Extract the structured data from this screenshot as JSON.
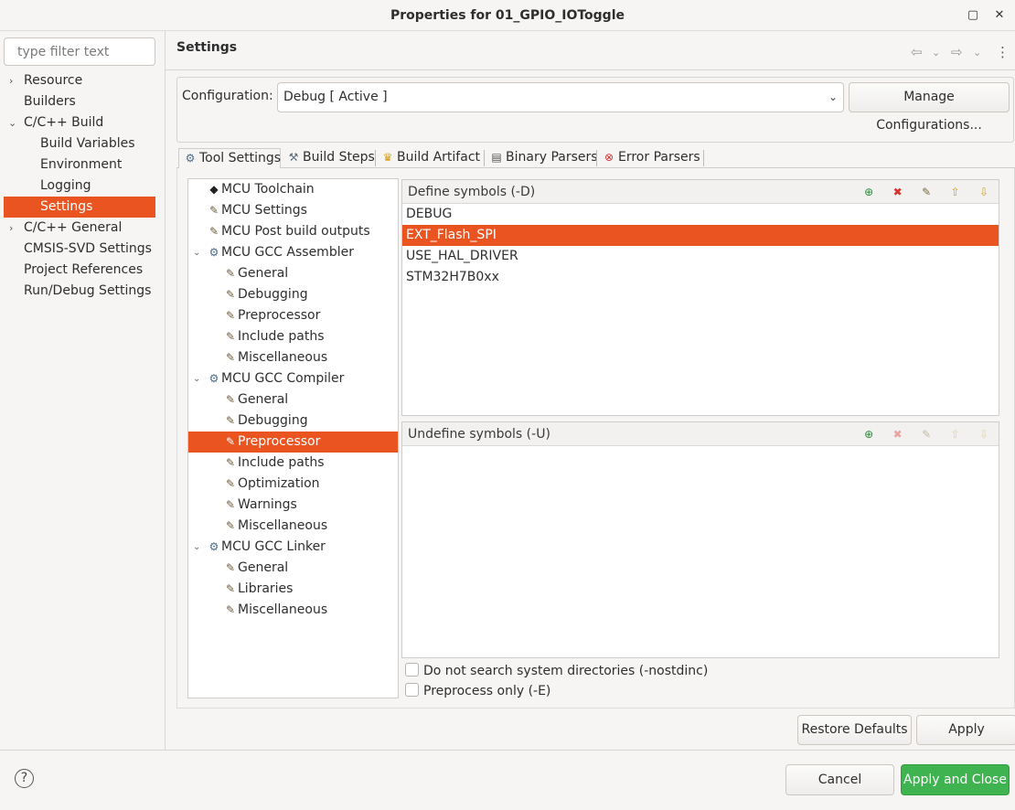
{
  "window": {
    "title": "Properties for 01_GPIO_IOToggle"
  },
  "filter": {
    "placeholder": "type filter text"
  },
  "nav": {
    "items": [
      {
        "label": "Resource",
        "arrow": "›"
      },
      {
        "label": "Builders"
      },
      {
        "label": "C/C++ Build",
        "arrow": "⌄"
      },
      {
        "label": "Build Variables"
      },
      {
        "label": "Environment"
      },
      {
        "label": "Logging"
      },
      {
        "label": "Settings",
        "selected": true
      },
      {
        "label": "C/C++ General",
        "arrow": "›"
      },
      {
        "label": "CMSIS-SVD Settings"
      },
      {
        "label": "Project References"
      },
      {
        "label": "Run/Debug Settings"
      }
    ]
  },
  "page": {
    "title": "Settings"
  },
  "config": {
    "label": "Configuration:",
    "value": "Debug  [ Active ]",
    "manage_label": "Manage Configurations..."
  },
  "tabs": [
    {
      "label": "Tool Settings",
      "icon": "tool-settings-icon",
      "active": true
    },
    {
      "label": "Build Steps",
      "icon": "build-steps-icon"
    },
    {
      "label": "Build Artifact",
      "icon": "trophy-icon"
    },
    {
      "label": "Binary Parsers",
      "icon": "binary-parser-icon"
    },
    {
      "label": "Error Parsers",
      "icon": "error-icon"
    }
  ],
  "tree": {
    "items": [
      {
        "label": "MCU Toolchain"
      },
      {
        "label": "MCU Settings"
      },
      {
        "label": "MCU Post build outputs"
      },
      {
        "label": "MCU GCC Assembler"
      },
      {
        "label": "General"
      },
      {
        "label": "Debugging"
      },
      {
        "label": "Preprocessor"
      },
      {
        "label": "Include paths"
      },
      {
        "label": "Miscellaneous"
      },
      {
        "label": "MCU GCC Compiler"
      },
      {
        "label": "General"
      },
      {
        "label": "Debugging"
      },
      {
        "label": "Preprocessor",
        "selected": true
      },
      {
        "label": "Include paths"
      },
      {
        "label": "Optimization"
      },
      {
        "label": "Warnings"
      },
      {
        "label": "Miscellaneous"
      },
      {
        "label": "MCU GCC Linker"
      },
      {
        "label": "General"
      },
      {
        "label": "Libraries"
      },
      {
        "label": "Miscellaneous"
      }
    ]
  },
  "define": {
    "title": "Define symbols (-D)",
    "symbols": [
      "DEBUG",
      "EXT_Flash_SPI",
      "USE_HAL_DRIVER",
      "STM32H7B0xx"
    ],
    "selected_index": 1
  },
  "undefine": {
    "title": "Undefine symbols (-U)",
    "symbols": []
  },
  "options": {
    "nostdinc_label": "Do not search system directories (-nostdinc)",
    "preprocess_only_label": "Preprocess only (-E)"
  },
  "buttons": {
    "restore": "Restore Defaults",
    "apply": "Apply",
    "cancel": "Cancel",
    "apply_close": "Apply and Close",
    "help": "?"
  },
  "colors": {
    "selection": "#e95420",
    "primary_button": "#3eb34f"
  }
}
